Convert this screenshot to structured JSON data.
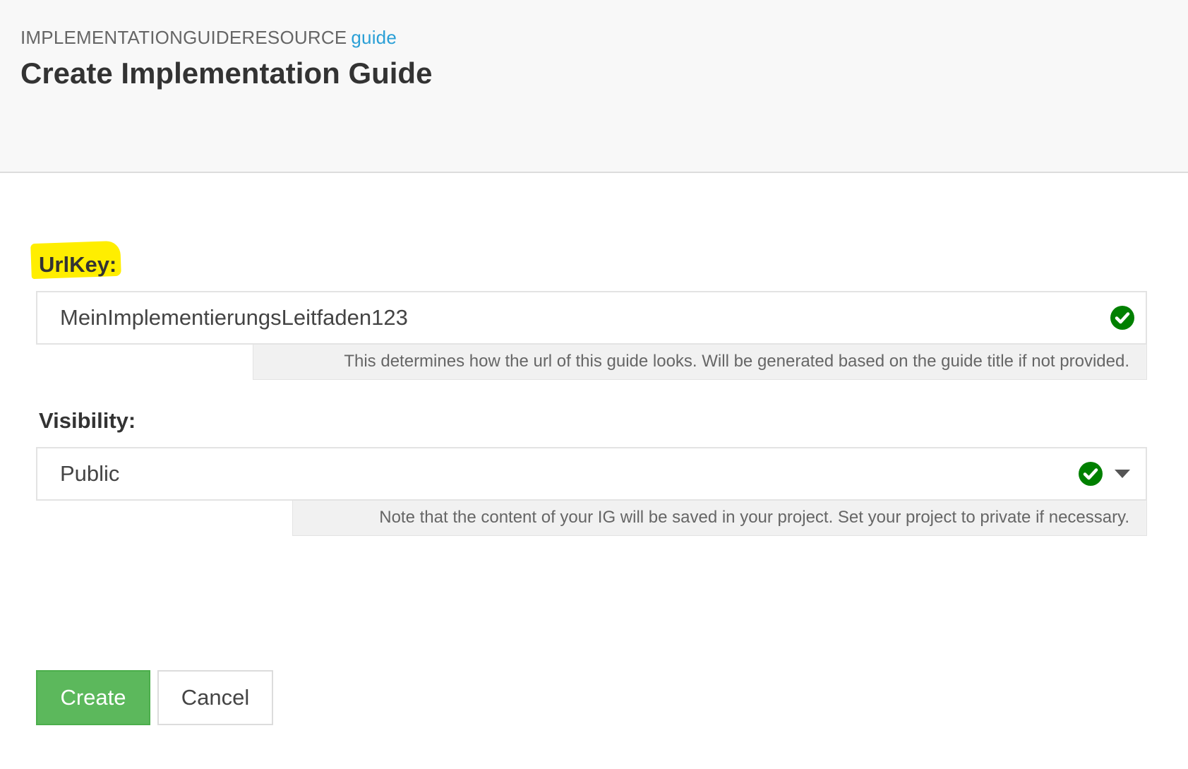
{
  "header": {
    "breadcrumb_prefix": "IMPLEMENTATIONGUIDERESOURCE",
    "breadcrumb_link": "guide",
    "title": "Create Implementation Guide"
  },
  "form": {
    "urlkey": {
      "label": "UrlKey:",
      "value": "MeinImplementierungsLeitfaden123",
      "status": "valid",
      "help": "This determines how the url of this guide looks. Will be generated based on the guide title if not provided."
    },
    "visibility": {
      "label": "Visibility:",
      "selected": "Public",
      "status": "valid",
      "help": "Note that the content of your IG will be saved in your project. Set your project to private if necessary."
    }
  },
  "actions": {
    "create_label": "Create",
    "cancel_label": "Cancel"
  },
  "colors": {
    "header_bg": "#f8f8f8",
    "link": "#2a9fd6",
    "highlight": "#ffee00",
    "valid_icon": "#008000",
    "create_button": "#5cb85c"
  },
  "icons": {
    "valid": "check-circle-icon",
    "dropdown": "caret-down-icon"
  }
}
